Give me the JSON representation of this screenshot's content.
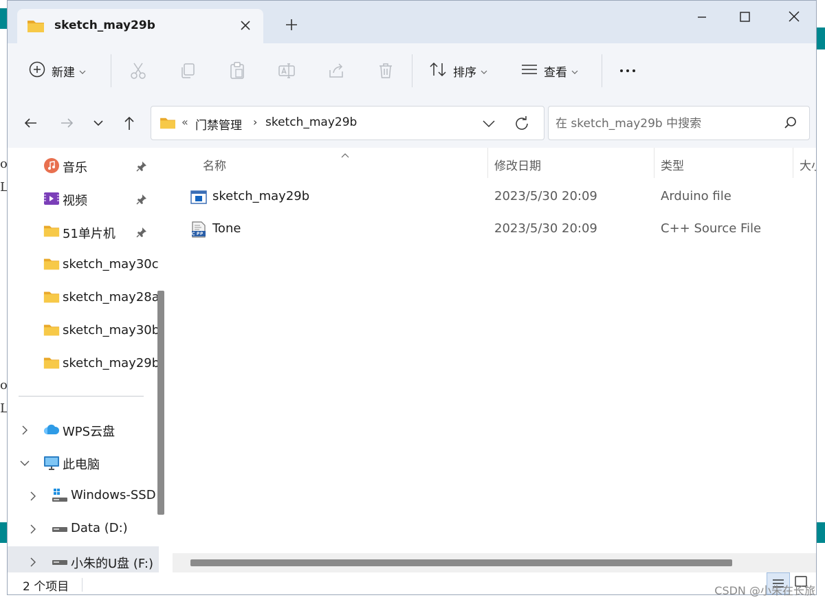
{
  "window": {
    "tab_title": "sketch_may29b"
  },
  "toolbar": {
    "new_label": "新建",
    "sort_label": "排序",
    "view_label": "查看"
  },
  "address": {
    "overflow": "«",
    "crumbs": [
      "门禁管理",
      "sketch_may29b"
    ],
    "separator": "›"
  },
  "search": {
    "placeholder": "在 sketch_may29b 中搜索"
  },
  "sidebar": {
    "quick_access": [
      {
        "label": "音乐",
        "icon": "music-icon",
        "pinned": true
      },
      {
        "label": "视频",
        "icon": "video-icon",
        "pinned": true
      },
      {
        "label": "51单片机",
        "icon": "folder-icon",
        "pinned": true
      },
      {
        "label": "sketch_may30c",
        "icon": "folder-icon",
        "pinned": false
      },
      {
        "label": "sketch_may28a",
        "icon": "folder-icon",
        "pinned": false
      },
      {
        "label": "sketch_may30b",
        "icon": "folder-icon",
        "pinned": false
      },
      {
        "label": "sketch_may29b",
        "icon": "folder-icon",
        "pinned": false
      }
    ],
    "tree": [
      {
        "label": "WPS云盘",
        "icon": "cloud-icon",
        "expanded": false
      },
      {
        "label": "此电脑",
        "icon": "computer-icon",
        "expanded": true
      },
      {
        "label": "Windows-SSD",
        "icon": "drive-windows-icon",
        "expanded": false
      },
      {
        "label": "Data (D:)",
        "icon": "drive-icon",
        "expanded": false
      },
      {
        "label": "小朱的U盘 (F:)",
        "icon": "drive-icon",
        "expanded": false,
        "selected": true
      }
    ]
  },
  "columns": [
    "名称",
    "修改日期",
    "类型",
    "大小"
  ],
  "files": [
    {
      "name": "sketch_may29b",
      "date": "2023/5/30 20:09",
      "type": "Arduino file",
      "icon": "arduino-file-icon"
    },
    {
      "name": "Tone",
      "date": "2023/5/30 20:09",
      "type": "C++ Source File",
      "icon": "cpp-file-icon"
    }
  ],
  "status": {
    "item_count": "2 个项目"
  },
  "watermark": "CSDN @小朱在长旅",
  "background_fragments": [
    "o",
    "L",
    "o",
    "L"
  ],
  "colors": {
    "titlebar": "#dfe7f2",
    "toolbar": "#f3f5f9",
    "teal_background": "#00878f",
    "folder_yellow": "#f5c542"
  }
}
